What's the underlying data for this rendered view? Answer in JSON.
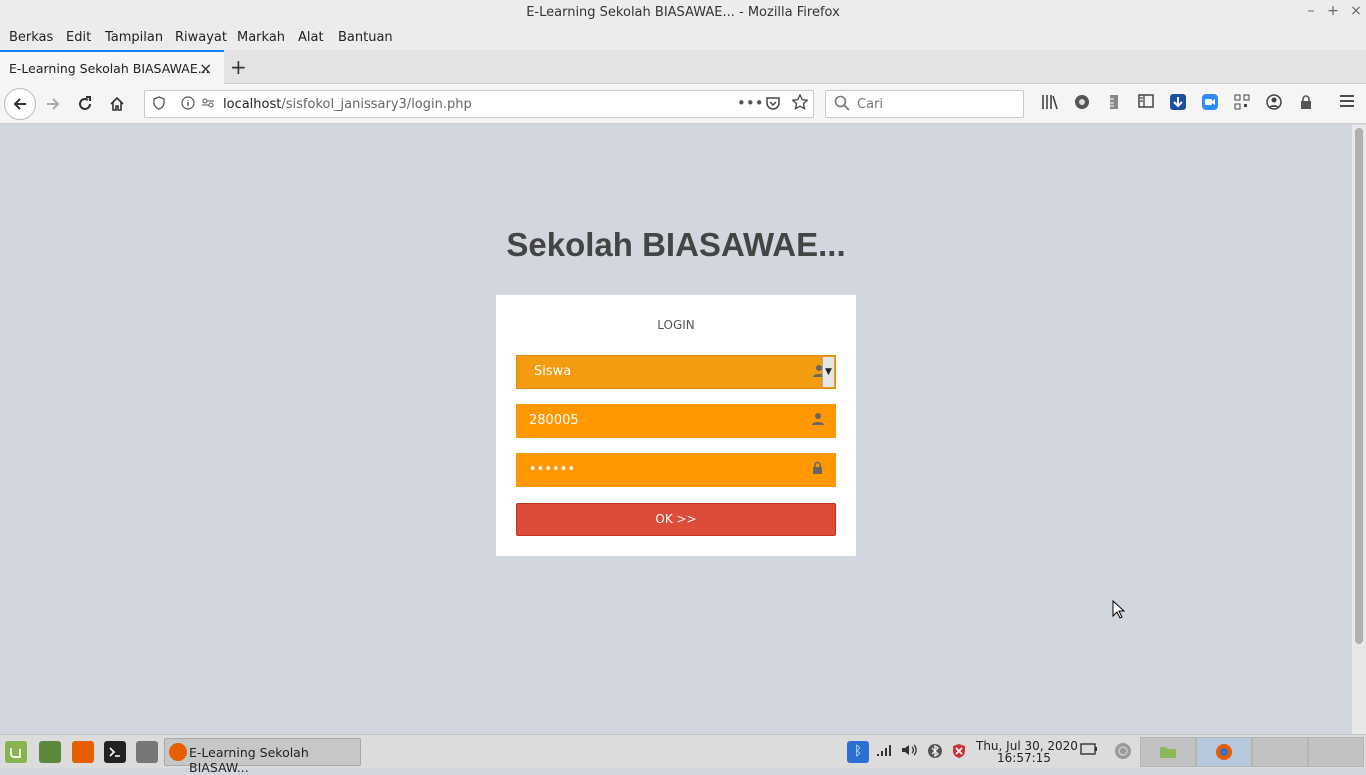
{
  "window": {
    "title": "E-Learning Sekolah BIASAWAE... - Mozilla Firefox",
    "controls": [
      "–",
      "+",
      "×"
    ]
  },
  "menu": [
    "Berkas",
    "Edit",
    "Tampilan",
    "Riwayat",
    "Markah",
    "Alat",
    "Bantuan"
  ],
  "tab": {
    "title": "E-Learning Sekolah BIASAWAE...",
    "close": "×",
    "new_tab": "+"
  },
  "nav": {
    "url_host": "localhost",
    "url_path": "/sisfokol_janissary3/login.php",
    "search_placeholder": "Cari"
  },
  "page": {
    "site_title": "Sekolah BIASAWAE...",
    "login_msg": "LOGIN",
    "role_select_value": "Siswa",
    "username_value": "280005",
    "password_value": "••••••",
    "submit_label": "OK >>",
    "colors": {
      "background": "#d2d6de",
      "field": "#ff9800",
      "button": "#dd4b39"
    }
  },
  "taskbar": {
    "active_task": "E-Learning Sekolah BIASAW...",
    "clock_date": "Thu, Jul 30, 2020",
    "clock_time": "16:57:15"
  }
}
